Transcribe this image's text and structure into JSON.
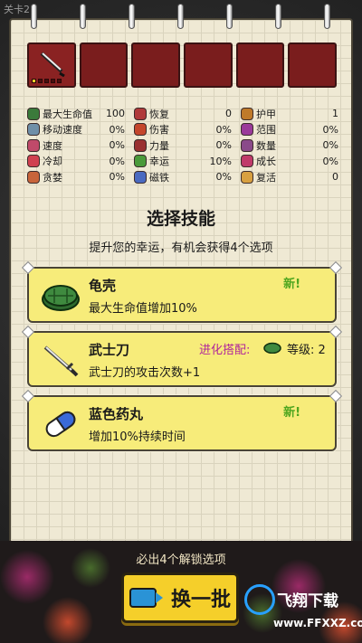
{
  "top_label": "关卡2",
  "slots": [
    {
      "filled": true,
      "item": "katana",
      "level": 1,
      "max_level": 5
    },
    {
      "filled": false
    },
    {
      "filled": false
    },
    {
      "filled": false
    },
    {
      "filled": false
    },
    {
      "filled": false
    }
  ],
  "stats": {
    "col1": [
      {
        "label": "最大生命值",
        "value": "100",
        "icon": "turtle-shell-icon",
        "color": "#3b7a3b"
      },
      {
        "label": "移动速度",
        "value": "0%",
        "icon": "boot-icon",
        "color": "#6f8fa8"
      },
      {
        "label": "速度",
        "value": "0%",
        "icon": "speed-icon",
        "color": "#c04a6a"
      },
      {
        "label": "冷却",
        "value": "0%",
        "icon": "cooldown-icon",
        "color": "#d04050"
      },
      {
        "label": "贪婪",
        "value": "0%",
        "icon": "greed-icon",
        "color": "#c8643a"
      }
    ],
    "col2": [
      {
        "label": "恢复",
        "value": "0",
        "icon": "recovery-icon",
        "color": "#b03a3a"
      },
      {
        "label": "伤害",
        "value": "0%",
        "icon": "damage-icon",
        "color": "#c4462c"
      },
      {
        "label": "力量",
        "value": "0%",
        "icon": "power-icon",
        "color": "#9a3030"
      },
      {
        "label": "幸运",
        "value": "10%",
        "icon": "clover-icon",
        "color": "#4a9a3a"
      },
      {
        "label": "磁铁",
        "value": "0%",
        "icon": "magnet-icon",
        "color": "#4a6ac0"
      }
    ],
    "col3": [
      {
        "label": "护甲",
        "value": "1",
        "icon": "armor-icon",
        "color": "#c07a2a"
      },
      {
        "label": "范围",
        "value": "0%",
        "icon": "range-icon",
        "color": "#9a3a9a"
      },
      {
        "label": "数量",
        "value": "0%",
        "icon": "amount-icon",
        "color": "#8a4a8a"
      },
      {
        "label": "成长",
        "value": "0%",
        "icon": "growth-icon",
        "color": "#c03a6a"
      },
      {
        "label": "复活",
        "value": "0",
        "icon": "revive-icon",
        "color": "#d8a040"
      }
    ]
  },
  "title": "选择技能",
  "subtitle": "提升您的幸运，有机会获得4个选项",
  "cards": [
    {
      "name": "龟壳",
      "desc": "最大生命值增加10%",
      "badge": "新!",
      "icon": "turtle-shell-icon"
    },
    {
      "name": "武士刀",
      "desc": "武士刀的攻击次数+1",
      "evo_label": "进化搭配:",
      "level_label": "等级: 2",
      "icon": "katana-icon"
    },
    {
      "name": "蓝色药丸",
      "desc": "增加10%持续时间",
      "badge": "新!",
      "icon": "pill-icon"
    }
  ],
  "unlock_text": "必出4个解锁选项",
  "refresh_label": "换一批",
  "watermark": {
    "brand": "飞翔下载",
    "url": "www.FFXXZ.com"
  },
  "colors": {
    "card": "#f7ec7a",
    "slot": "#7a1d1d",
    "button": "#f5cf2a",
    "new": "#4fa61f",
    "evo": "#b0249b"
  }
}
